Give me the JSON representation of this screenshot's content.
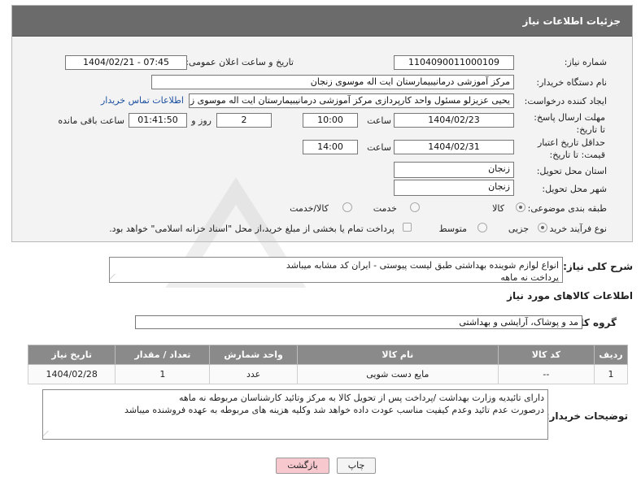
{
  "panel": {
    "title": "جزئیات اطلاعات نیاز"
  },
  "form": {
    "need_number_label": "شماره نیاز:",
    "need_number": "1104090011000109",
    "announce_label": "تاریخ و ساعت اعلان عمومی:",
    "announce_value": "1404/02/21 - 07:45",
    "buyer_org_label": "نام دستگاه خریدار:",
    "buyer_org": "مرکز آموزشی درمانیبیمارستان ایت اله موسوی زنجان",
    "creator_label": "ایجاد کننده درخواست:",
    "creator": "یحیی عزیزلو مسئول واحد کارپردازی مرکز آموزشی درمانیبیمارستان ایت اله موسوی زنجان",
    "contact_link": "اطلاعات تماس خریدار",
    "deadline_label": "مهلت ارسال پاسخ: تا تاریخ:",
    "deadline_date": "1404/02/23",
    "time_label": "ساعت",
    "deadline_time": "10:00",
    "days_value": "2",
    "days_label": "روز و",
    "remaining_time": "01:41:50",
    "remaining_label": "ساعت باقی مانده",
    "min_price_label": "حداقل تاریخ اعتبار قیمت: تا تاریخ:",
    "min_price_date": "1404/02/31",
    "min_price_time": "14:00",
    "province_label": "استان محل تحویل:",
    "province": "زنجان",
    "city_label": "شهر محل تحویل:",
    "city": "زنجان",
    "category_label": "طبقه بندی موضوعی:",
    "category_options": [
      "کالا",
      "خدمت",
      "کالا/خدمت"
    ],
    "purchase_type_label": "نوع فرآیند خرید :",
    "purchase_options": [
      "جزیی",
      "متوسط"
    ],
    "payment_note": "پرداخت تمام یا بخشی از مبلغ خرید،از محل \"اسناد خزانه اسلامی\" خواهد بود."
  },
  "description": {
    "label": "شرح کلی نیاز:",
    "line1": "انواع لوازم شوینده بهداشتی طبق لیست پیوستی - ایران کد مشابه میباشد",
    "line2": "پرداخت نه ماهه"
  },
  "goods": {
    "section_title": "اطلاعات کالاهای مورد نیاز",
    "group_label": "گروه کالا:",
    "group_value": "مد و پوشاک، آرایشی و بهداشتی",
    "columns": [
      "ردیف",
      "کد کالا",
      "نام کالا",
      "واحد شمارش",
      "تعداد / مقدار",
      "تاریخ نیاز"
    ],
    "rows": [
      [
        "1",
        "--",
        "مایع دست شویی",
        "عدد",
        "1",
        "1404/02/28"
      ]
    ]
  },
  "buyer_notes": {
    "label": "توضیحات خریدار:",
    "line1": "دارای تائیدیه وزارت بهداشت /پرداخت پس از تحویل کالا به مرکز وتائید کارشناسان مربوطه نه ماهه",
    "line2": "درصورت عدم تائید وعدم کیفیت مناسب عودت داده خواهد شد وکلیه هزینه های مربوطه به عهده فروشنده میباشد"
  },
  "buttons": {
    "print": "چاپ",
    "back": "بازگشت"
  },
  "watermark": {
    "text": "AriaTender.neT"
  },
  "colors": {
    "header_bg": "#6b6b6b",
    "link": "#1a4fa0",
    "back_btn": "#f7c9cf"
  }
}
